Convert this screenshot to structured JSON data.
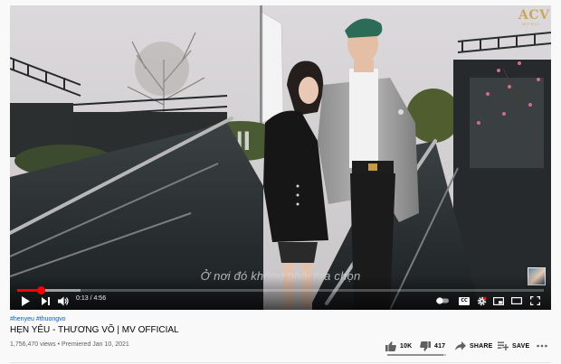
{
  "player": {
    "watermark_main": "ACV",
    "watermark_sub": "MUSIC",
    "subtitle": "Ở nơi đó không phải lựa chọn",
    "time_current": "0:13",
    "time_separator": " / ",
    "time_total": "4:56",
    "progress_played": 0.044,
    "progress_loaded": 0.12,
    "cc_label": "CC",
    "accent_color": "#ff0000"
  },
  "video": {
    "hashtags": [
      "#henyeu",
      "#thuongvo"
    ],
    "title": "HẸN YÊU - THƯƠNG VÕ | MV OFFICIAL",
    "views": "1,756,470 views",
    "separator": "•",
    "premiered": "Premiered Jan 10, 2021",
    "like_ratio": 0.96
  },
  "actions": {
    "like_count": "10K",
    "dislike_count": "417",
    "share_label": "SHARE",
    "save_label": "SAVE"
  },
  "colors": {
    "link": "#065fd4",
    "progress": "#ff0000",
    "text_secondary": "#606060"
  }
}
